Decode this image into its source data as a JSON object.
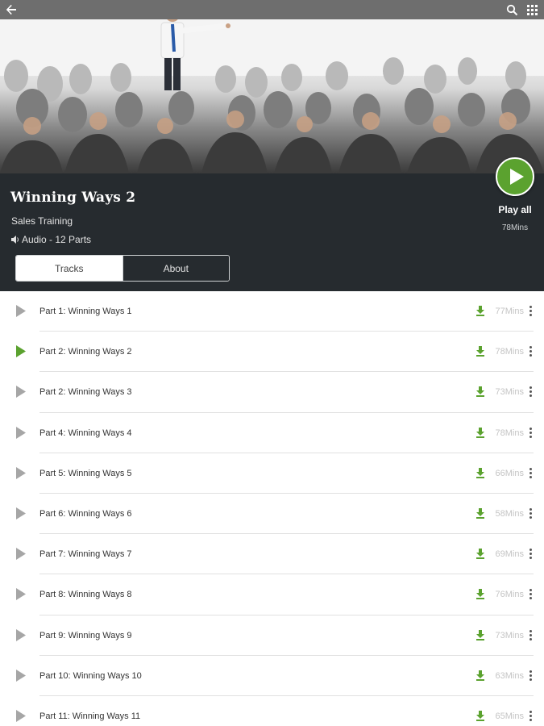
{
  "topbar": {
    "back_icon": "arrow-left-icon",
    "search_icon": "search-icon",
    "menu_icon": "grid-icon"
  },
  "program": {
    "title": "Winning Ways 2",
    "category": "Sales Training",
    "meta": "Audio - 12 Parts"
  },
  "tabs": [
    {
      "label": "Tracks",
      "active": true
    },
    {
      "label": "About",
      "active": false
    }
  ],
  "play_all": {
    "label": "Play all",
    "duration": "78Mins"
  },
  "colors": {
    "accent": "#5ba22f",
    "panel": "#262b2f"
  },
  "tracks": [
    {
      "title": "Part 1: Winning Ways 1",
      "duration": "77Mins",
      "playing": false
    },
    {
      "title": "Part 2: Winning Ways 2",
      "duration": "78Mins",
      "playing": true
    },
    {
      "title": "Part 2: Winning Ways 3",
      "duration": "73Mins",
      "playing": false
    },
    {
      "title": "Part 4: Winning Ways 4",
      "duration": "78Mins",
      "playing": false
    },
    {
      "title": "Part 5: Winning Ways 5",
      "duration": "66Mins",
      "playing": false
    },
    {
      "title": "Part 6: Winning Ways 6",
      "duration": "58Mins",
      "playing": false
    },
    {
      "title": "Part 7: Winning Ways 7",
      "duration": "69Mins",
      "playing": false
    },
    {
      "title": "Part 8: Winning Ways 8",
      "duration": "76Mins",
      "playing": false
    },
    {
      "title": "Part 9: Winning Ways 9",
      "duration": "73Mins",
      "playing": false
    },
    {
      "title": "Part 10: Winning Ways 10",
      "duration": "63Mins",
      "playing": false
    },
    {
      "title": "Part 11: Winning Ways 11",
      "duration": "65Mins",
      "playing": false
    }
  ]
}
